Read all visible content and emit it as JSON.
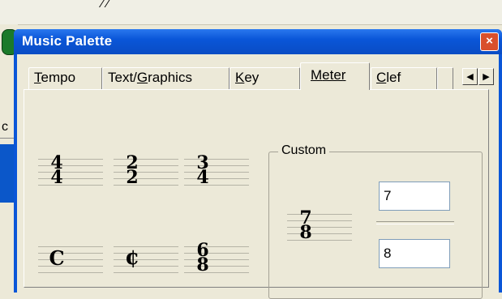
{
  "background": {
    "fragment_text": "⁄ ⁄",
    "left_letter": "c"
  },
  "window": {
    "title": "Music Palette",
    "close_symbol": "×"
  },
  "tabs": [
    {
      "pre": "",
      "u": "T",
      "post": "empo",
      "active": false
    },
    {
      "pre": "Text/",
      "u": "G",
      "post": "raphics",
      "active": false
    },
    {
      "pre": "",
      "u": "K",
      "post": "ey",
      "active": false
    },
    {
      "pre": "",
      "u": "M",
      "post": "eter",
      "active": true
    },
    {
      "pre": "",
      "u": "C",
      "post": "lef",
      "active": false
    }
  ],
  "scroll": {
    "left": "◀",
    "right": "▶"
  },
  "meters": {
    "m44": {
      "top": "4",
      "bottom": "4"
    },
    "m22": {
      "top": "2",
      "bottom": "2"
    },
    "m34": {
      "top": "3",
      "bottom": "4"
    },
    "common": "C",
    "cut": "¢",
    "m68": {
      "top": "6",
      "bottom": "8"
    }
  },
  "custom": {
    "label": "Custom",
    "preview": {
      "top": "7",
      "bottom": "8"
    },
    "numerator_value": "7",
    "denominator_value": "8"
  }
}
